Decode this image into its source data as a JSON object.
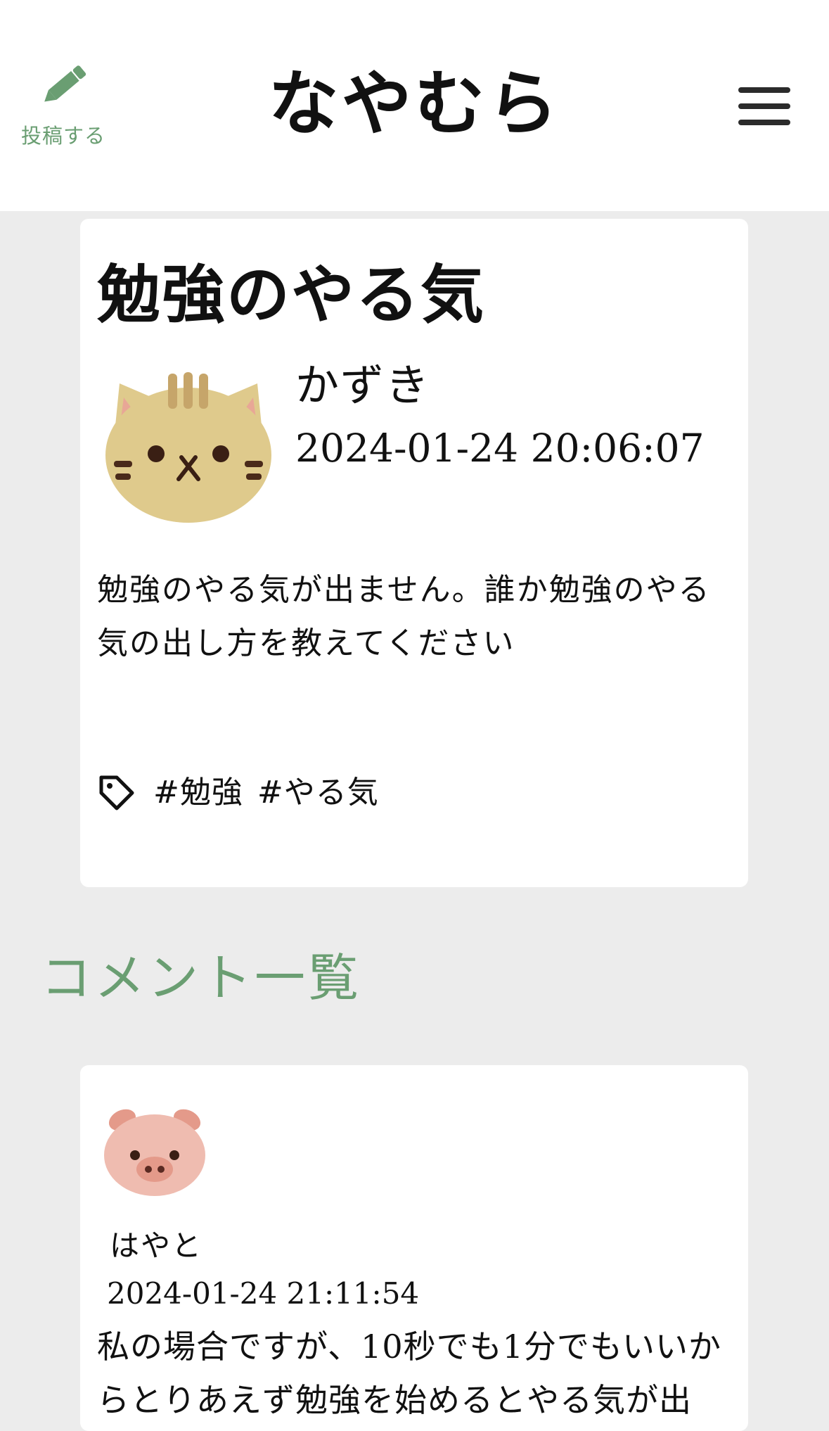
{
  "header": {
    "post_label": "投稿する",
    "site_title": "なやむら"
  },
  "post": {
    "title": "勉強のやる気",
    "author": "かずき",
    "date": "2024-01-24 20:06:07",
    "body": "勉強のやる気が出ません。誰か勉強のやる気の出し方を教えてください",
    "tags": [
      "#勉強",
      "#やる気"
    ]
  },
  "comments": {
    "heading": "コメント一覧",
    "items": [
      {
        "author": "はやと",
        "date": "2024-01-24 21:11:54",
        "body": "私の場合ですが、10秒でも1分でもいいからとりあえず勉強を始めるとやる気が出"
      }
    ]
  },
  "colors": {
    "accent": "#6a9e72",
    "background": "#ececec",
    "card": "#ffffff"
  },
  "icons": {
    "post": "pencil-icon",
    "menu": "hamburger-menu-icon",
    "tag": "tag-icon",
    "post_avatar": "cat-avatar-icon",
    "comment_avatar": "pig-avatar-icon"
  }
}
